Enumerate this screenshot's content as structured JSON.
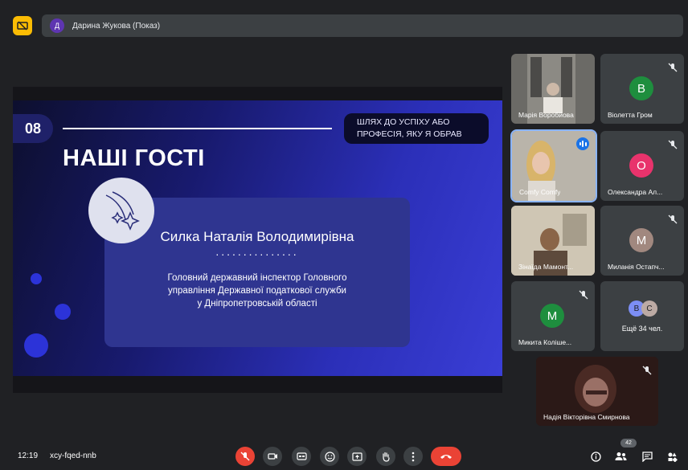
{
  "presenter_bar": {
    "avatar_letter": "Д",
    "label": "Дарина Жукова (Показ)"
  },
  "slide": {
    "number": "08",
    "badge_line1": "ШЛЯХ ДО УСПІХУ АБО",
    "badge_line2": "ПРОФЕСІЯ, ЯКУ Я ОБРАВ",
    "heading": "НАШІ ГОСТІ",
    "guest_name": "Силка Наталія Володимирівна",
    "guest_dots": "...............",
    "guest_desc_line1": "Головний державний інспектор Головного",
    "guest_desc_line2": "управління Державної податкової служби",
    "guest_desc_line3": "у Дніпропетровській області"
  },
  "participants": [
    {
      "name": "Марія Воробйова",
      "letter": "",
      "color": "",
      "video": true,
      "muted": false
    },
    {
      "name": "Віолетта Гром",
      "letter": "В",
      "color": "#1e8e3e",
      "video": false,
      "muted": true
    },
    {
      "name": "Comfy Comfy",
      "letter": "",
      "color": "",
      "video": true,
      "muted": false,
      "speaking": true
    },
    {
      "name": "Олександра Ал...",
      "letter": "О",
      "color": "#e8336c",
      "video": false,
      "muted": true
    },
    {
      "name": "Зінаїда Мамонт...",
      "letter": "",
      "color": "",
      "video": true,
      "muted": false
    },
    {
      "name": "Миланія Остапч...",
      "letter": "М",
      "color": "#a1887f",
      "video": false,
      "muted": true
    },
    {
      "name": "Микита Колішe...",
      "letter": "М",
      "color": "#1e8e3e",
      "video": false,
      "muted": true
    },
    {
      "name": "Надія Вікторівна Смирнова",
      "letter": "",
      "color": "",
      "video": true,
      "muted": true
    }
  ],
  "more": {
    "avatar1": "В",
    "avatar1_color": "#7c8ef5",
    "avatar2": "С",
    "avatar2_color": "#bcaaa4",
    "label": "Ещё 34 чел."
  },
  "bottom": {
    "time": "12:19",
    "meeting_code": "xcy-fqed-nnb",
    "participant_count": "42"
  },
  "colors": {
    "background": "#202124",
    "tile": "#3c4043",
    "accent_red": "#ea4335",
    "accent_blue": "#1a73e8",
    "present_yellow": "#fbbc04"
  }
}
